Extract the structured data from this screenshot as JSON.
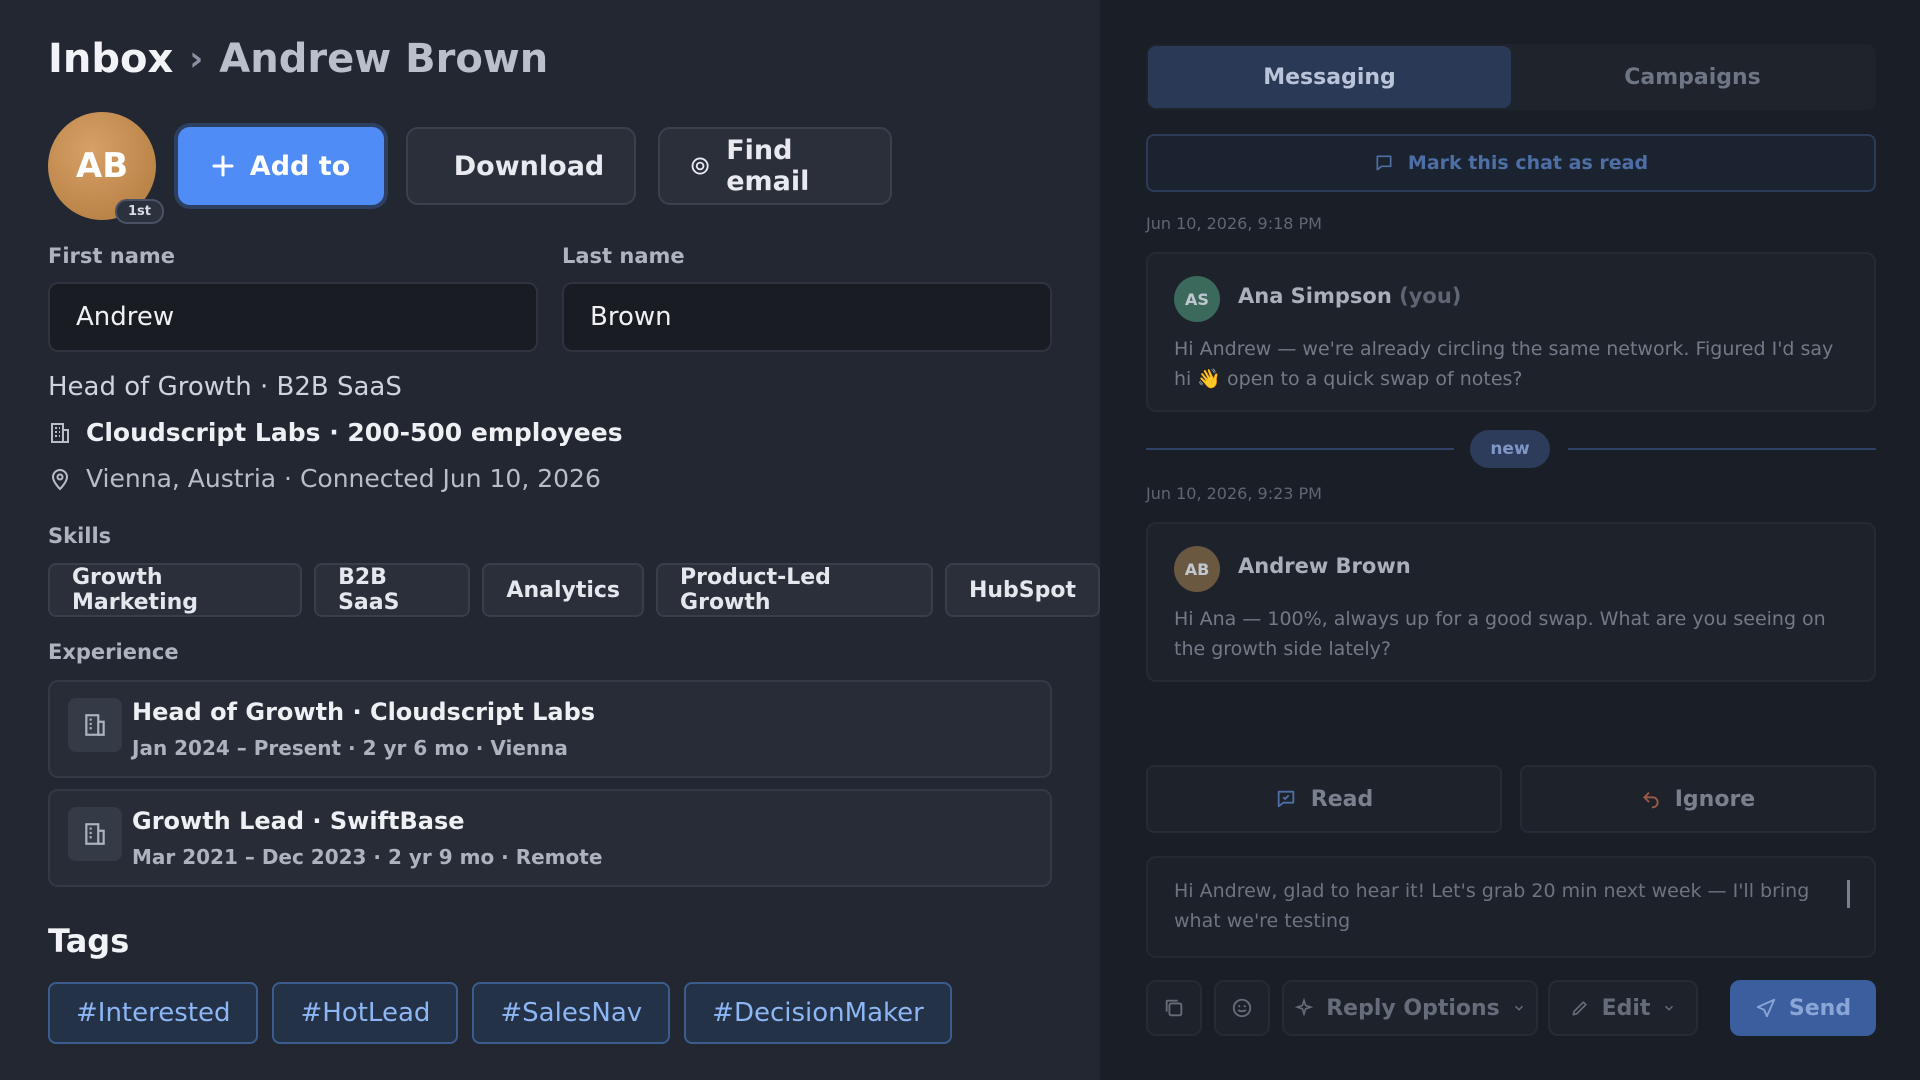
{
  "breadcrumb": {
    "root": "Inbox",
    "separator": "›",
    "current": "Andrew Brown"
  },
  "profile": {
    "initials": "AB",
    "degree": "1st",
    "first_name_label": "First name",
    "first_name": "Andrew",
    "last_name_label": "Last name",
    "last_name": "Brown",
    "headline": "Head of Growth · B2B SaaS",
    "company": "Cloudscript Labs · 200-500 employees",
    "location": "Vienna, Austria · Connected Jun 10, 2026"
  },
  "actions": {
    "add_to": "Add to",
    "download": "Download",
    "find_email": "Find email"
  },
  "skills": {
    "label": "Skills",
    "items": [
      "Growth Marketing",
      "B2B SaaS",
      "Analytics",
      "Product-Led Growth",
      "HubSpot"
    ]
  },
  "experience": {
    "label": "Experience",
    "items": [
      {
        "title": "Head of Growth · Cloudscript Labs",
        "subtitle": "Jan 2024 – Present · 2 yr 6 mo · Vienna"
      },
      {
        "title": "Growth Lead · SwiftBase",
        "subtitle": "Mar 2021 – Dec 2023 · 2 yr 9 mo · Remote"
      }
    ]
  },
  "tags": {
    "label": "Tags",
    "items": [
      "#Interested",
      "#HotLead",
      "#SalesNav",
      "#DecisionMaker"
    ]
  },
  "chat": {
    "tabs": [
      "Messaging",
      "Campaigns"
    ],
    "active_tab": "Messaging",
    "mark_read": "Mark this chat as read",
    "messages": [
      {
        "timestamp": "Jun 10, 2026, 9:18 PM",
        "initials": "AS",
        "sender": "Ana Simpson",
        "you_label": "(you)",
        "body": "Hi Andrew — we're already circling the same network. Figured I'd say hi 👋 open to a quick swap of notes?"
      },
      {
        "timestamp": "Jun 10, 2026, 9:23 PM",
        "initials": "AB",
        "sender": "Andrew Brown",
        "body": "Hi Ana — 100%, always up for a good swap. What are you seeing on the growth side lately?"
      }
    ],
    "new_label": "new",
    "read_button": "Read",
    "ignore_button": "Ignore",
    "draft": "Hi Andrew, glad to hear it! Let's grab 20 min next week — I'll bring what we're testing",
    "reply_options": "Reply Options",
    "edit": "Edit",
    "send": "Send"
  },
  "colors": {
    "accent": "#4f8cf5",
    "tag_text": "#8db6f5",
    "avatar": "#c48e52"
  }
}
